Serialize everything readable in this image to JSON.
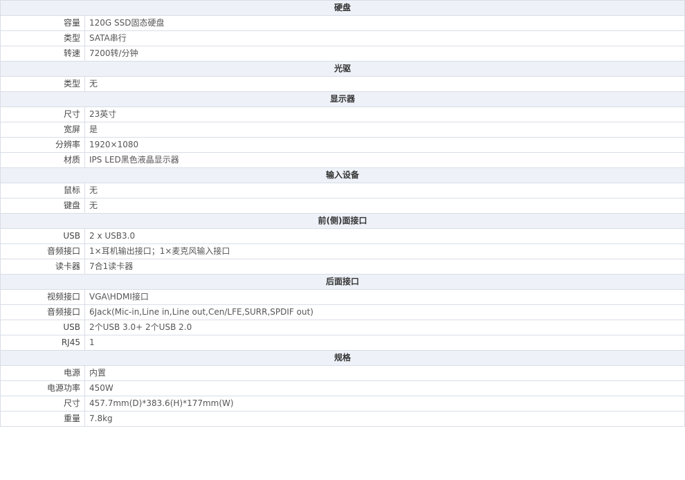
{
  "sections": [
    {
      "title": "硬盘",
      "rows": [
        {
          "label": "容量",
          "value": "120G SSD固态硬盘"
        },
        {
          "label": "类型",
          "value": "SATA串行"
        },
        {
          "label": "转速",
          "value": "7200转/分钟"
        }
      ]
    },
    {
      "title": "光驱",
      "rows": [
        {
          "label": "类型",
          "value": "无"
        }
      ]
    },
    {
      "title": "显示器",
      "rows": [
        {
          "label": "尺寸",
          "value": "23英寸"
        },
        {
          "label": "宽屏",
          "value": "是"
        },
        {
          "label": "分辨率",
          "value": "1920×1080"
        },
        {
          "label": "材质",
          "value": "IPS LED黑色液晶显示器"
        }
      ]
    },
    {
      "title": "输入设备",
      "rows": [
        {
          "label": "鼠标",
          "value": "无"
        },
        {
          "label": "键盘",
          "value": "无"
        }
      ]
    },
    {
      "title": "前(侧)面接口",
      "rows": [
        {
          "label": "USB",
          "value": "2 x USB3.0"
        },
        {
          "label": "音频接口",
          "value": "1×耳机输出接口；1×麦克风输入接口"
        },
        {
          "label": "读卡器",
          "value": "7合1读卡器"
        }
      ]
    },
    {
      "title": "后面接口",
      "rows": [
        {
          "label": "视频接口",
          "value": "VGA\\HDMI接口"
        },
        {
          "label": "音频接口",
          "value": "6Jack(Mic-in,Line in,Line out,Cen/LFE,SURR,SPDIF out)"
        },
        {
          "label": "USB",
          "value": "2个USB 3.0+ 2个USB 2.0"
        },
        {
          "label": "RJ45",
          "value": "1"
        }
      ]
    },
    {
      "title": "规格",
      "rows": [
        {
          "label": "电源",
          "value": "内置"
        },
        {
          "label": "电源功率",
          "value": "450W"
        },
        {
          "label": "尺寸",
          "value": "457.7mm(D)*383.6(H)*177mm(W)"
        },
        {
          "label": "重量",
          "value": "7.8kg"
        }
      ]
    }
  ]
}
